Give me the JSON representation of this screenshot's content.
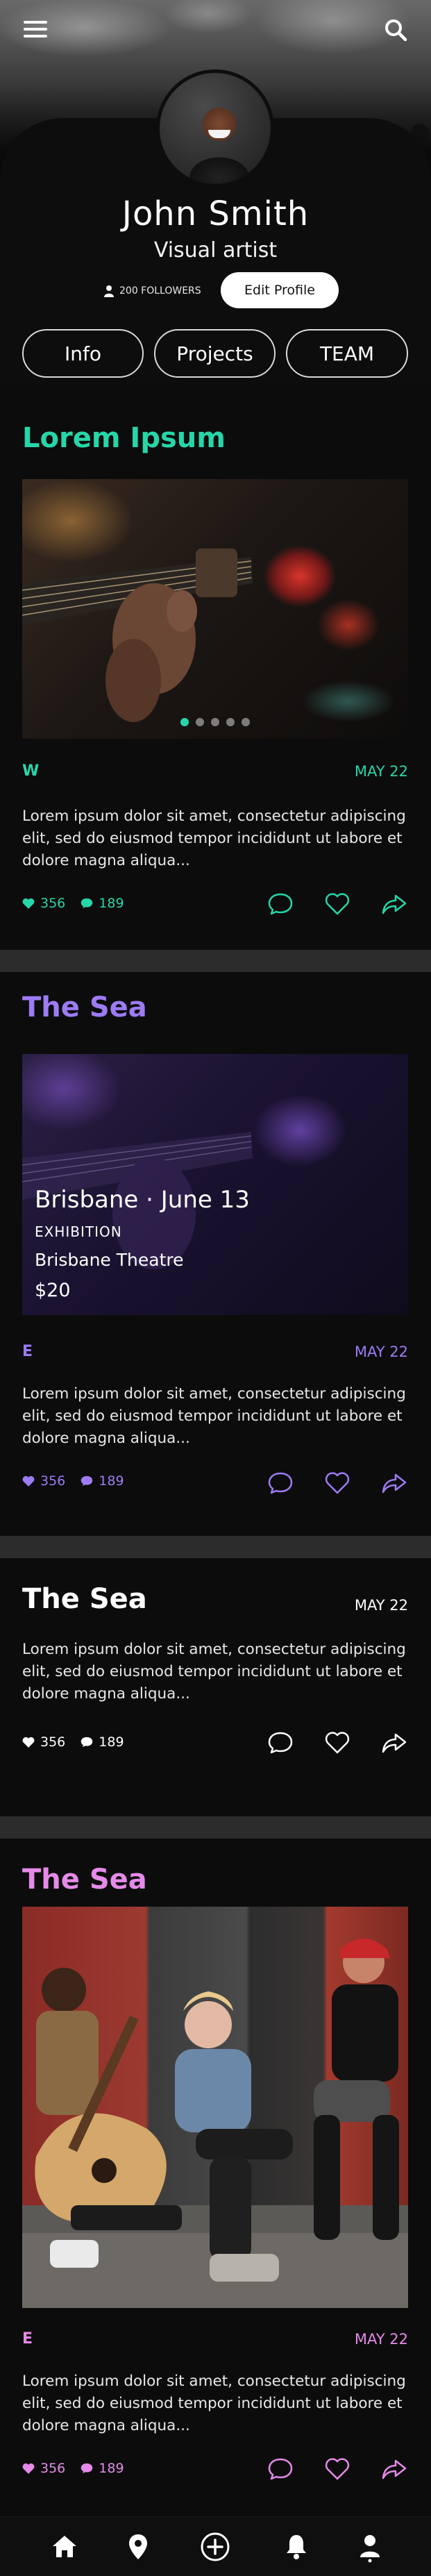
{
  "profile": {
    "name": "John Smith",
    "role": "Visual artist",
    "followers": "200 FOLLOWERS",
    "edit_label": "Edit Profile"
  },
  "tabs": [
    {
      "label": "Info"
    },
    {
      "label": "Projects"
    },
    {
      "label": "TEAM"
    }
  ],
  "posts": [
    {
      "title": "Lorem Ipsum",
      "tag": "W",
      "date": "MAY 22",
      "body": "Lorem ipsum dolor sit amet, consectetur adipiscing elit, sed do eiusmod tempor incididunt ut labore et dolore magna aliqua...",
      "likes": "356",
      "comments": "189",
      "accent": "#27d6a8",
      "carousel_pages": 5,
      "carousel_active": 1
    },
    {
      "title": "The Sea",
      "tag": "E",
      "date": "MAY 22",
      "body": "Lorem ipsum dolor sit amet, consectetur adipiscing elit, sed do eiusmod tempor incididunt ut labore et dolore magna aliqua...",
      "likes": "356",
      "comments": "189",
      "accent": "#9d7bf5",
      "event": {
        "city_date": "Brisbane · June 13",
        "type": "EXHIBITION",
        "venue": "Brisbane Theatre",
        "price": "$20"
      }
    },
    {
      "title": "The Sea",
      "date": "MAY 22",
      "body": "Lorem ipsum dolor sit amet, consectetur adipiscing elit, sed do eiusmod tempor incididunt ut labore et dolore magna aliqua...",
      "likes": "356",
      "comments": "189",
      "accent": "#ffffff"
    },
    {
      "title": "The Sea",
      "tag": "E",
      "date": "MAY 22",
      "body": "Lorem ipsum dolor sit amet, consectetur adipiscing elit, sed do eiusmod tempor incididunt ut labore et dolore magna aliqua...",
      "likes": "356",
      "comments": "189",
      "accent": "#e58ae8"
    }
  ],
  "nav": [
    {
      "icon": "home-icon"
    },
    {
      "icon": "location-pin-icon"
    },
    {
      "icon": "add-circle-icon"
    },
    {
      "icon": "bell-icon"
    },
    {
      "icon": "user-icon"
    }
  ],
  "colors": {
    "background": "#0c0c0c",
    "separator": "#2c2c2c",
    "teal": "#27d6a8",
    "purple": "#9d7bf5",
    "pink": "#e58ae8"
  }
}
